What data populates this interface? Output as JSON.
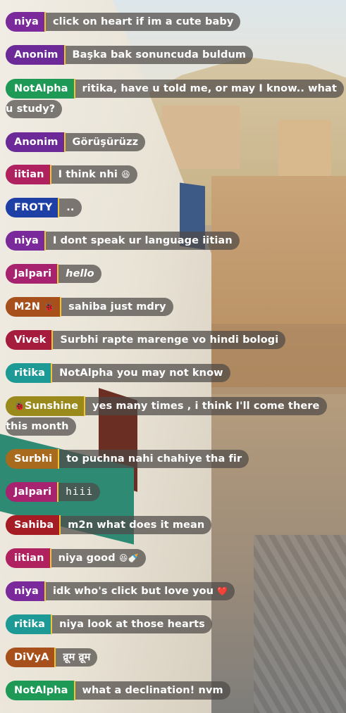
{
  "messages": [
    {
      "user": "niya",
      "text": "click on heart if im a cute baby",
      "color": "#7a2a9a"
    },
    {
      "user": "Anonim",
      "text": "Başka bak sonuncuda buldum",
      "color": "#6b2a98"
    },
    {
      "user": "NotAlpha",
      "text": "ritika, have u told me, or may I know.. what u study?",
      "color": "#1e9a56"
    },
    {
      "user": "Anonim",
      "text": "Görüşürüzz",
      "color": "#6b2a98"
    },
    {
      "user": "iitian",
      "text": "I think nhi",
      "color": "#b0225f",
      "emoji": "😆"
    },
    {
      "user": "FROTY",
      "text": "..",
      "color": "#1e3fa6"
    },
    {
      "user": "niya",
      "text": "I dont speak ur language iitian",
      "color": "#7a2a9a"
    },
    {
      "user": "Jalpari",
      "text": "hello",
      "color": "#a8236f",
      "style": "italic"
    },
    {
      "user": "M2N",
      "text": "sahiba just mdry",
      "color": "#a8501c",
      "badge": "🐞"
    },
    {
      "user": "Vivek",
      "text": "Surbhi rapte marenge vo hindi bologi",
      "color": "#a61c3c"
    },
    {
      "user": "ritika",
      "text": "NotAlpha you may not know",
      "color": "#1e9a96"
    },
    {
      "user": "Sunshine",
      "text": "yes many times , i think I'll come there this month",
      "color": "#9a8a1c",
      "badge": "🐞"
    },
    {
      "user": "Surbhi",
      "text": "to puchna nahi chahiye tha fir",
      "color": "#a86a1c"
    },
    {
      "user": "Jalpari",
      "text": "hiii",
      "color": "#a8236f",
      "style": "mono"
    },
    {
      "user": "Sahiba",
      "text": "m2n what does it mean",
      "color": "#a61c24"
    },
    {
      "user": "iitian",
      "text": "niya good",
      "color": "#b0225f",
      "emoji": "😆🍼"
    },
    {
      "user": "niya",
      "text": "idk who's click but love you",
      "color": "#7a2a9a",
      "emoji": "❤️"
    },
    {
      "user": "ritika",
      "text": "niya look at those hearts",
      "color": "#1e9a96"
    },
    {
      "user": "DiVyA",
      "text": "व्रूम व्रूम",
      "color": "#a8501c"
    },
    {
      "user": "NotAlpha",
      "text": "what a declination! nvm",
      "color": "#1e9a56"
    }
  ]
}
